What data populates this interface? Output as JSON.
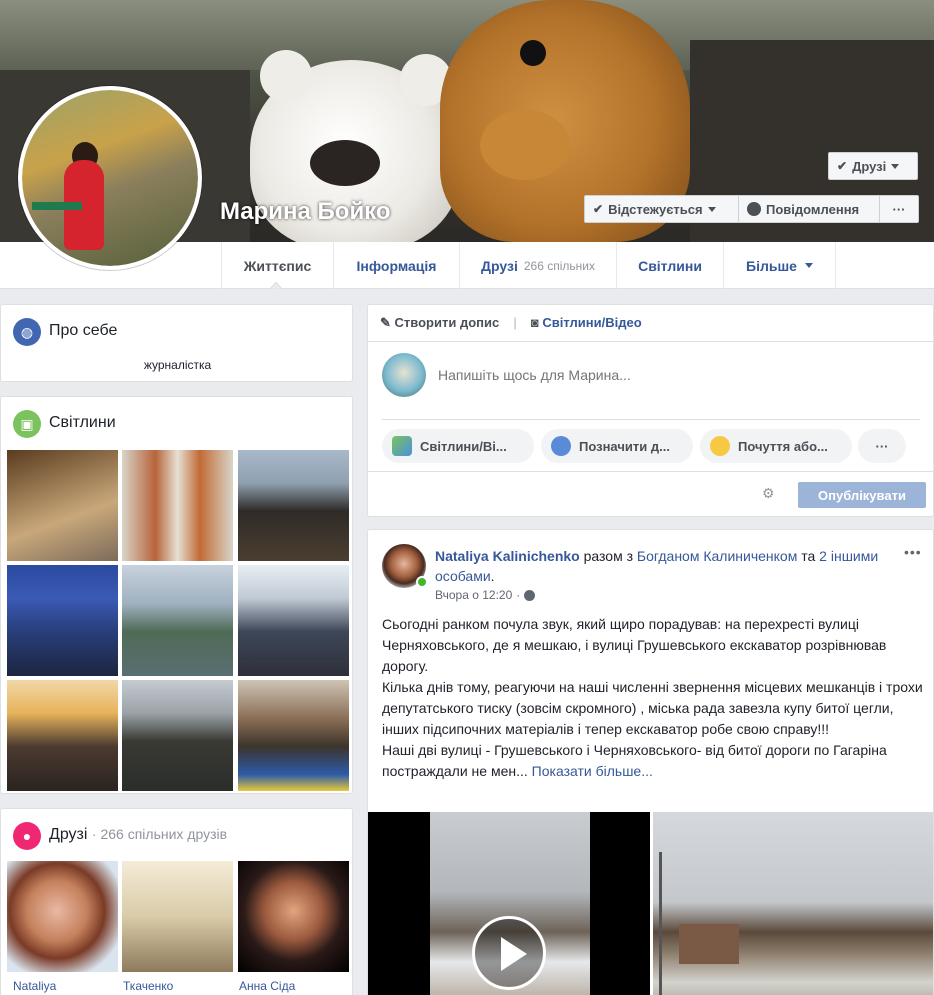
{
  "profile": {
    "name": "Марина Бойко",
    "friends_button": "Друзі",
    "follow_button": "Відстежується",
    "message_button": "Повідомлення",
    "more_button": "···"
  },
  "tabs": [
    {
      "label": "Життєпис"
    },
    {
      "label": "Інформація"
    },
    {
      "label": "Друзі",
      "sub": "266 спільних"
    },
    {
      "label": "Світлини"
    },
    {
      "label": "Більше"
    }
  ],
  "about": {
    "title": "Про себе",
    "text": "журналістка"
  },
  "photos": {
    "title": "Світлини"
  },
  "friends": {
    "title": "Друзі",
    "subtitle": "· 266 спільних друзів",
    "items": [
      {
        "name": "Nataliya"
      },
      {
        "name": "Ткаченко"
      },
      {
        "name": "Анна Сіда"
      }
    ]
  },
  "composer": {
    "create_post": "Створити допис",
    "photo_video": "Світлини/Відео",
    "placeholder": "Напишіть щось для Марина...",
    "pills": [
      {
        "label": "Світлини/Ві..."
      },
      {
        "label": "Позначити д..."
      },
      {
        "label": "Почуття або..."
      }
    ],
    "more": "···",
    "publish": "Опублікувати"
  },
  "post": {
    "author": "Nataliya Kalinichenko",
    "with_text": "разом з",
    "with_person": "Богданом Калиниченком",
    "and_text": "та",
    "others": "2 іншими особами",
    "period": ".",
    "time": "Вчора о 12:20",
    "separator": "·",
    "more_menu": "•••",
    "paragraphs": [
      "Сьогодні ранком почула звук, який щиро порадував: на перехресті вулиці Черняховського, де я мешкаю, і вулиці Грушевського екскаватор розрівнював дорогу.",
      "Кілька днів тому, реагуючи на наші численні звернення місцевих мешканців і трохи депутатського тиску (зовсім скромного) , міська рада завезла купу битої цегли, інших підсипочних матеріалів і тепер екскаватор робе свою справу!!!",
      "Наші дві вулиці - Грушевського і Черняховського- від битої дороги по Гагаріна постраждали не мен..."
    ],
    "show_more": "Показати більше..."
  },
  "colors": {
    "link": "#365899",
    "publish_bg": "#9cb4d8",
    "background": "#e9ebee"
  }
}
